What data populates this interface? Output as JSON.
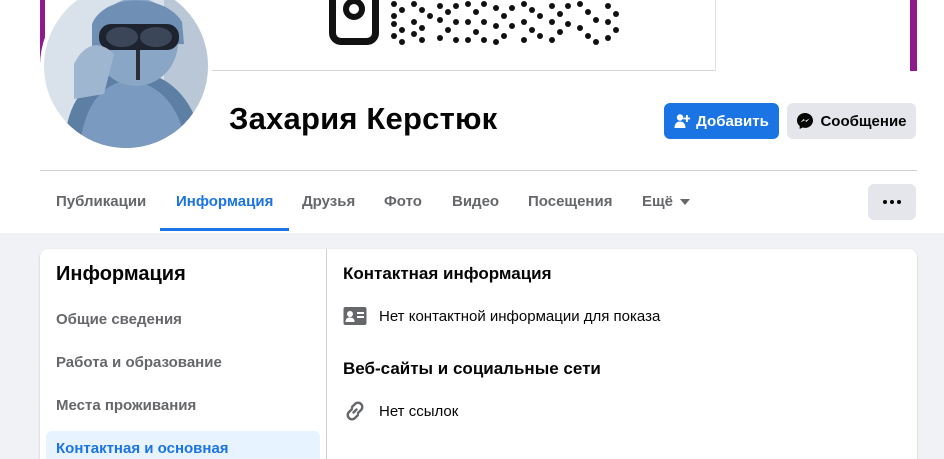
{
  "profile": {
    "name": "Захария Керстюк"
  },
  "actions": {
    "add_label": "Добавить",
    "message_label": "Сообщение"
  },
  "tabs": [
    {
      "label": "Публикации"
    },
    {
      "label": "Информация",
      "active": true
    },
    {
      "label": "Друзья"
    },
    {
      "label": "Фото"
    },
    {
      "label": "Видео"
    },
    {
      "label": "Посещения"
    },
    {
      "label": "Ещё"
    }
  ],
  "sidebar": {
    "title": "Информация",
    "items": [
      {
        "label": "Общие сведения"
      },
      {
        "label": "Работа и образование"
      },
      {
        "label": "Места проживания"
      },
      {
        "label": "Контактная и основная",
        "active": true
      }
    ]
  },
  "content": {
    "contact": {
      "title": "Контактная информация",
      "empty_text": "Нет контактной информации для показа",
      "icon": "contact-card-icon"
    },
    "websites": {
      "title": "Веб-сайты и социальные сети",
      "empty_text": "Нет ссылок",
      "icon": "link-icon"
    }
  },
  "colors": {
    "accent": "#1b74e4",
    "cover_frame": "#8e1a8e",
    "background": "#f0f2f5"
  }
}
